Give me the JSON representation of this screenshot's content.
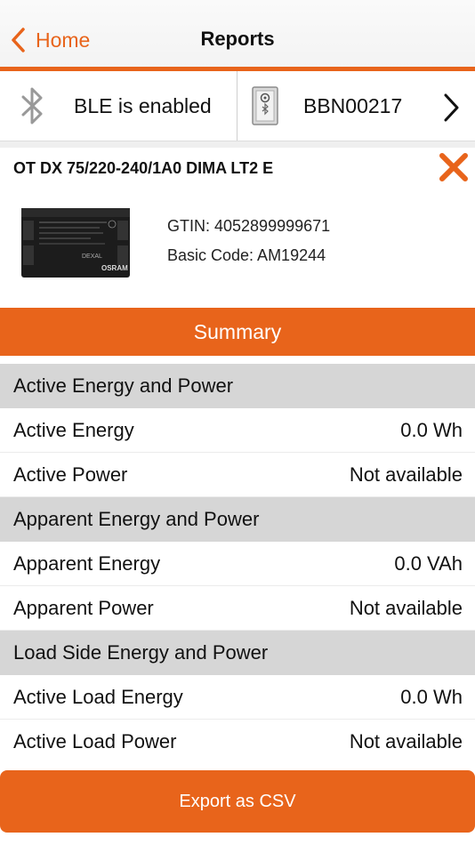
{
  "nav": {
    "back_label": "Home",
    "title": "Reports"
  },
  "ble": {
    "status": "BLE is enabled",
    "device_id": "BBN00217"
  },
  "product": {
    "name": "OT DX 75/220-240/1A0 DIMA LT2 E",
    "gtin": "GTIN: 4052899999671",
    "basic_code": "Basic Code: AM19244",
    "brand_label": "OSRAM",
    "model_label": "DEXAL"
  },
  "summary_label": "Summary",
  "sections": [
    {
      "title": "Active Energy and Power",
      "rows": [
        {
          "label": "Active Energy",
          "value": "0.0 Wh"
        },
        {
          "label": "Active Power",
          "value": "Not available"
        }
      ]
    },
    {
      "title": "Apparent Energy and Power",
      "rows": [
        {
          "label": "Apparent Energy",
          "value": "0.0 VAh"
        },
        {
          "label": "Apparent Power",
          "value": "Not available"
        }
      ]
    },
    {
      "title": "Load Side Energy and Power",
      "rows": [
        {
          "label": "Active Load Energy",
          "value": "0.0 Wh"
        },
        {
          "label": "Active Load Power",
          "value": "Not available"
        }
      ]
    }
  ],
  "export_label": "Export as CSV",
  "colors": {
    "accent": "#e8641b",
    "section_bg": "#d6d6d6"
  },
  "icons": [
    "chevron-left-icon",
    "bluetooth-icon",
    "device-icon",
    "chevron-right-icon",
    "close-icon"
  ]
}
